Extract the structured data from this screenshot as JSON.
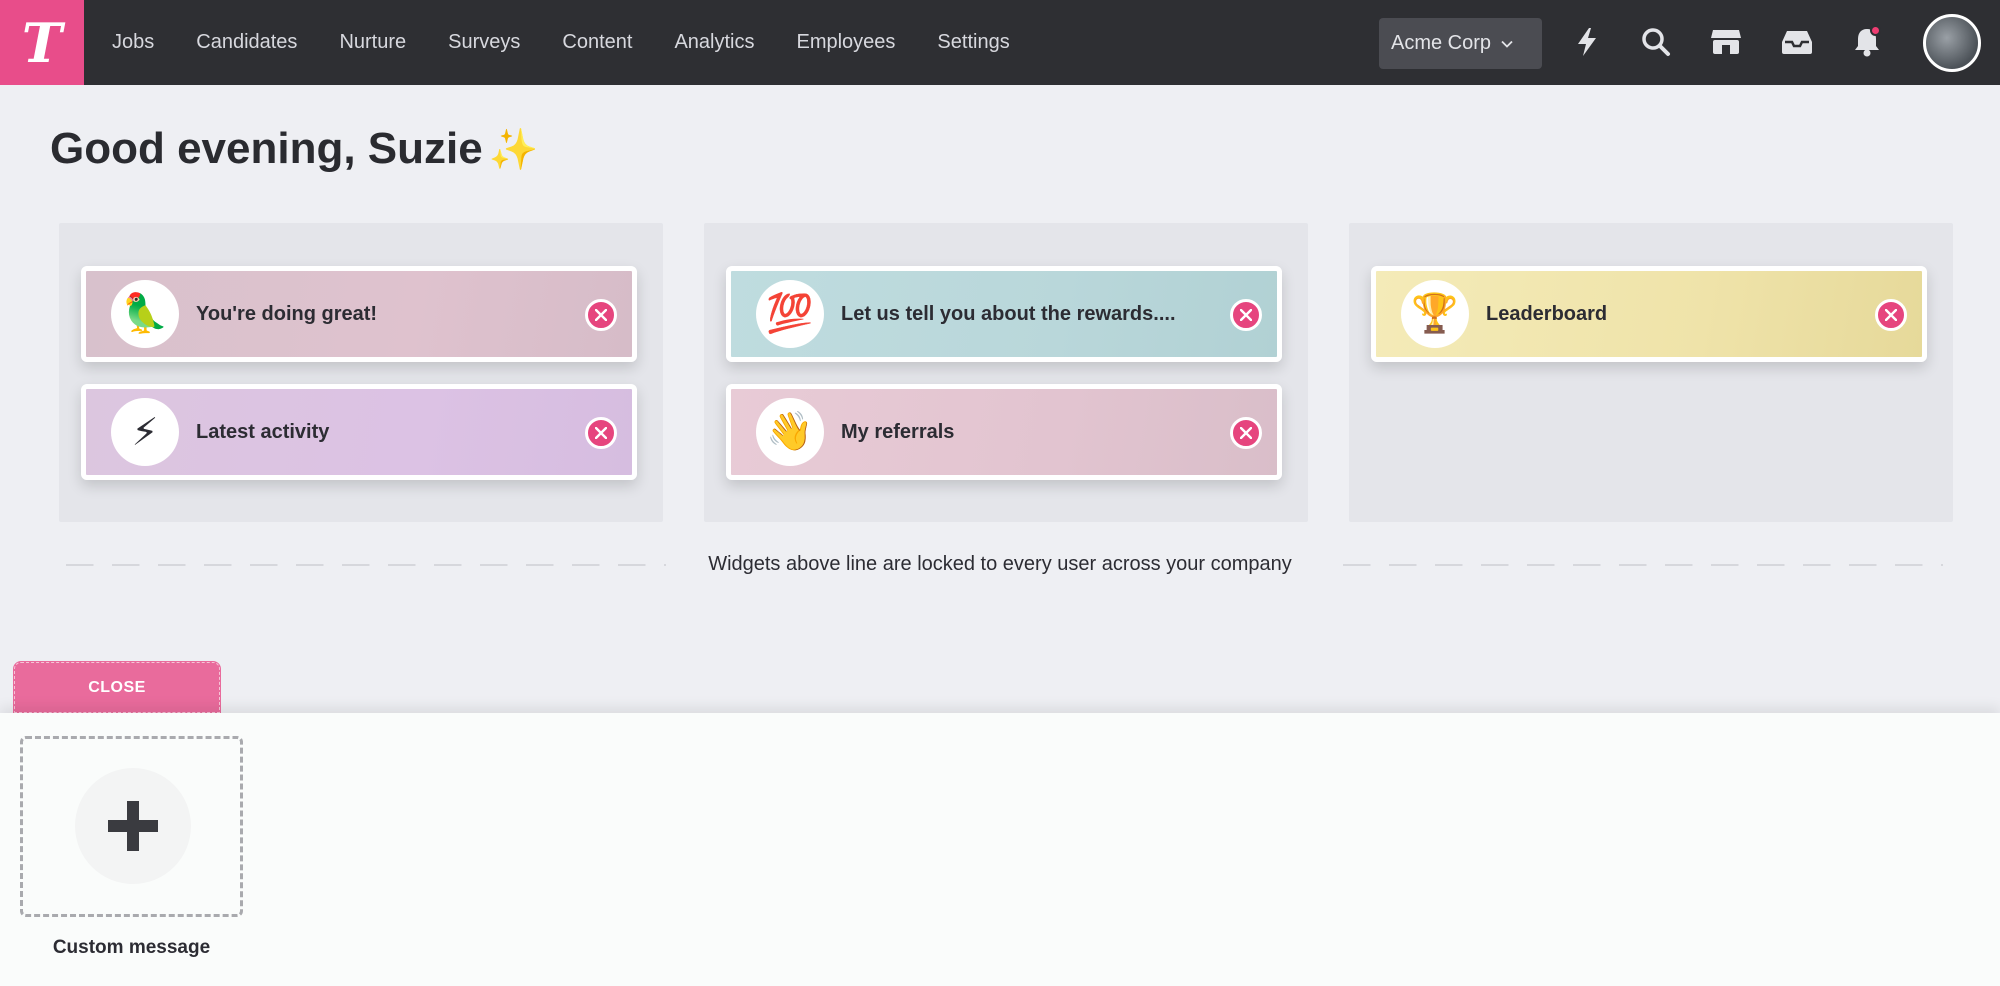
{
  "nav": {
    "logo_letter": "T",
    "links": [
      "Jobs",
      "Candidates",
      "Nurture",
      "Surveys",
      "Content",
      "Analytics",
      "Employees",
      "Settings"
    ],
    "company": "Acme Corp",
    "icons": [
      "lightning-icon",
      "search-icon",
      "store-icon",
      "inbox-icon",
      "bell-icon"
    ],
    "notification_dot_color": "#ef3d72"
  },
  "greeting": {
    "text": "Good evening, Suzie",
    "emoji": "✨"
  },
  "columns": [
    {
      "widgets": [
        {
          "emoji": "🦜",
          "label": "You're doing great!",
          "gradient": [
            "#d9c1cc",
            "#dcbfcd"
          ]
        },
        {
          "emoji": "⚡",
          "label": "Latest activity",
          "gradient": [
            "#dcc3e0",
            "#dbbde6"
          ]
        }
      ]
    },
    {
      "widgets": [
        {
          "emoji": "💯",
          "label": "Let us tell you about the rewards....",
          "gradient": [
            "#c1dcdf",
            "#b4d3d6"
          ]
        },
        {
          "emoji": "👋",
          "label": "My referrals",
          "gradient": [
            "#e6c5d2",
            "#dbbfca"
          ]
        }
      ]
    },
    {
      "widgets": [
        {
          "emoji": "🏆",
          "label": "Leaderboard",
          "gradient": [
            "#f3e9b4",
            "#e9dc9d"
          ]
        }
      ]
    }
  ],
  "divider": {
    "text": "Widgets above line are locked to every user across your company"
  },
  "drawer": {
    "close_label": "CLOSE",
    "add_widget_caption": "Custom message"
  },
  "colors": {
    "brand_pink": "#e84d8a",
    "nav_bg": "#2e2f33",
    "remove_button": "#e6457e"
  }
}
